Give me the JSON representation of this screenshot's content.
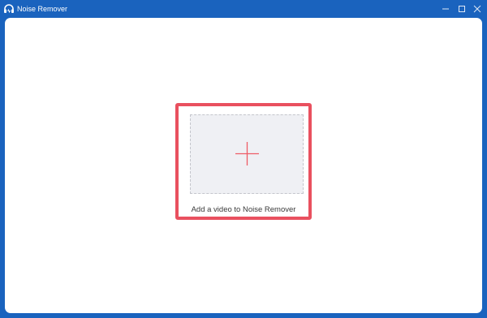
{
  "window": {
    "title": "Noise Remover",
    "app_icon": "headphones-icon",
    "controls": {
      "minimize_icon": "minimize-icon",
      "maximize_icon": "maximize-icon",
      "close_icon": "close-icon"
    }
  },
  "main": {
    "add_icon": "plus-icon",
    "add_label": "Add a video to Noise Remover"
  },
  "colors": {
    "titlebar": "#1a63be",
    "highlight_border": "#e9505f",
    "plus": "#ee5b66",
    "drop_zone_bg": "#eff0f4"
  }
}
